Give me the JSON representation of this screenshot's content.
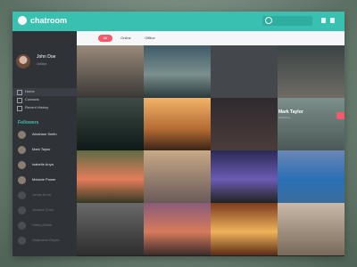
{
  "app": {
    "name": "chatroom"
  },
  "user": {
    "name": "John Doe",
    "status": "Online"
  },
  "menu": [
    {
      "label": "Home"
    },
    {
      "label": "Contacts"
    },
    {
      "label": "Recent History"
    }
  ],
  "followers": {
    "title": "Followers",
    "items": [
      {
        "name": "Abraham Smith",
        "sub": "",
        "count": ""
      },
      {
        "name": "Mark Taylor",
        "sub": "",
        "count": ""
      },
      {
        "name": "Isabelle Anya",
        "sub": "",
        "count": ""
      },
      {
        "name": "Melanie Power",
        "sub": "",
        "count": ""
      },
      {
        "name": "Jonas Anna",
        "sub": "",
        "count": ""
      },
      {
        "name": "Jessica Chen",
        "sub": "",
        "count": ""
      },
      {
        "name": "Haley Alldon",
        "sub": "",
        "count": ""
      },
      {
        "name": "Stephanie Reyes",
        "sub": "",
        "count": ""
      }
    ]
  },
  "filters": {
    "all": "All",
    "online": "Online",
    "offline": "Offline"
  },
  "profile_card": {
    "name": "Mark Taylor",
    "sub": "Following"
  }
}
